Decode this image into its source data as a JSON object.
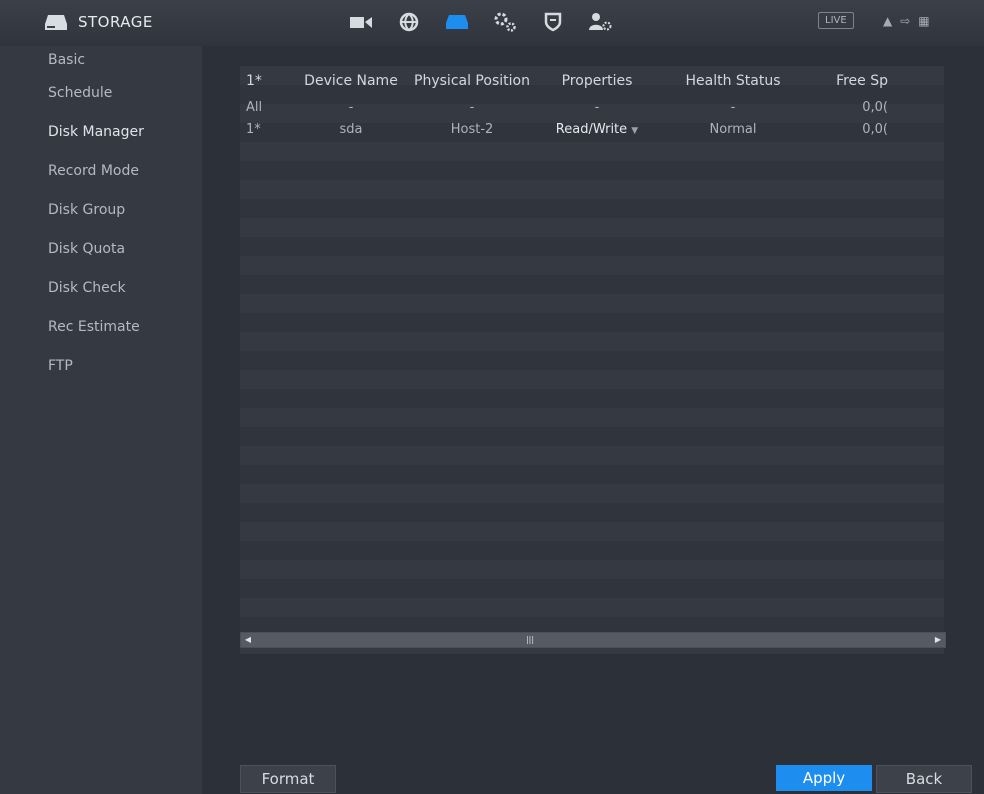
{
  "header": {
    "title": "STORAGE",
    "live_label": "LIVE",
    "menu_icons": [
      "camera-icon",
      "network-icon",
      "storage-icon",
      "system-settings-icon",
      "security-shield-icon",
      "account-icon"
    ]
  },
  "sidebar": {
    "items": [
      {
        "label": "Basic"
      },
      {
        "label": "Schedule"
      },
      {
        "label": "Disk Manager"
      },
      {
        "label": "Record Mode"
      },
      {
        "label": "Disk Group"
      },
      {
        "label": "Disk Quota"
      },
      {
        "label": "Disk Check"
      },
      {
        "label": "Rec Estimate"
      },
      {
        "label": "FTP"
      }
    ]
  },
  "table": {
    "columns": [
      "1*",
      "Device Name",
      "Physical Position",
      "Properties",
      "Health Status",
      "Free Sp"
    ],
    "rows": [
      {
        "cells": [
          "All",
          "-",
          "-",
          "-",
          "-",
          "0,0("
        ]
      },
      {
        "cells": [
          "1*",
          "sda",
          "Host-2",
          "Read/Write",
          "Normal",
          "0,0("
        ]
      }
    ]
  },
  "buttons": {
    "format": "Format",
    "apply": "Apply",
    "back": "Back"
  },
  "colors": {
    "accent": "#1d8ef0",
    "background": "#2c3038",
    "sidebar": "#343942"
  }
}
